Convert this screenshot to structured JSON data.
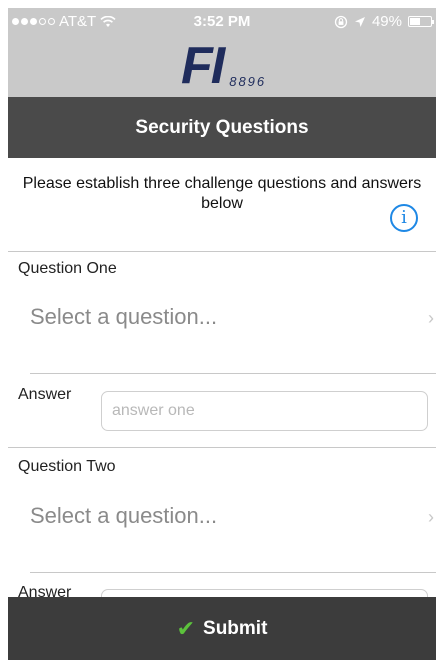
{
  "status_bar": {
    "carrier": "AT&T",
    "time": "3:52 PM",
    "battery": "49%",
    "battery_level": 0.49
  },
  "logo": {
    "brand": "FI",
    "number": "8896"
  },
  "header": {
    "title": "Security Questions"
  },
  "intro": {
    "text": "Please establish three challenge questions and answers below"
  },
  "questions": [
    {
      "label": "Question One",
      "select_placeholder": "Select a question...",
      "answer_label": "Answer",
      "answer_placeholder": "answer one"
    },
    {
      "label": "Question Two",
      "select_placeholder": "Select a question...",
      "answer_label": "Answer",
      "answer_placeholder": ""
    }
  ],
  "submit": {
    "label": "Submit"
  },
  "colors": {
    "brand_navy": "#1f2c5c",
    "header_gray": "#c9c9c9",
    "bar_dark": "#4a4a4a",
    "accent_blue": "#1e88e5",
    "check_green": "#5cc23c"
  },
  "icons": [
    "wifi-icon",
    "lock-rotation-icon",
    "location-arrow-icon",
    "battery-icon",
    "info-icon",
    "chevron-right-icon",
    "checkmark-icon"
  ]
}
